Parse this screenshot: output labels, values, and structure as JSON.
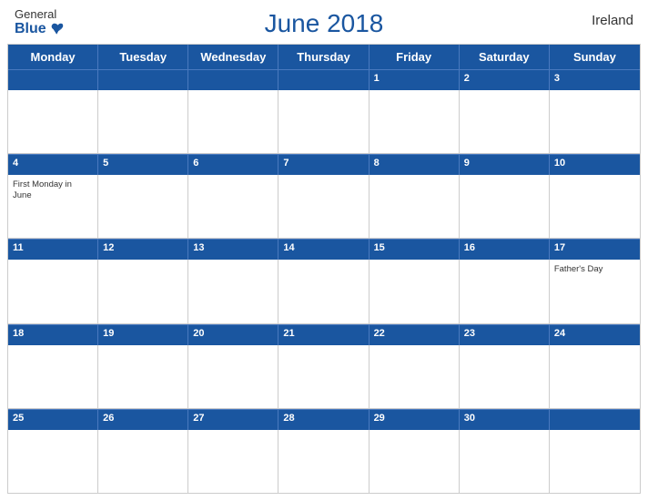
{
  "header": {
    "title": "June 2018",
    "country": "Ireland",
    "logo": {
      "general": "General",
      "blue": "Blue"
    }
  },
  "days": [
    "Monday",
    "Tuesday",
    "Wednesday",
    "Thursday",
    "Friday",
    "Saturday",
    "Sunday"
  ],
  "weeks": [
    {
      "numbers": [
        "",
        "",
        "",
        "",
        "1",
        "2",
        "3"
      ],
      "holidays": [
        "",
        "",
        "",
        "",
        "",
        "",
        ""
      ]
    },
    {
      "numbers": [
        "4",
        "5",
        "6",
        "7",
        "8",
        "9",
        "10"
      ],
      "holidays": [
        "First Monday in June",
        "",
        "",
        "",
        "",
        "",
        ""
      ]
    },
    {
      "numbers": [
        "11",
        "12",
        "13",
        "14",
        "15",
        "16",
        "17"
      ],
      "holidays": [
        "",
        "",
        "",
        "",
        "",
        "",
        "Father's Day"
      ]
    },
    {
      "numbers": [
        "18",
        "19",
        "20",
        "21",
        "22",
        "23",
        "24"
      ],
      "holidays": [
        "",
        "",
        "",
        "",
        "",
        "",
        ""
      ]
    },
    {
      "numbers": [
        "25",
        "26",
        "27",
        "28",
        "29",
        "30",
        ""
      ],
      "holidays": [
        "",
        "",
        "",
        "",
        "",
        "",
        ""
      ]
    }
  ]
}
